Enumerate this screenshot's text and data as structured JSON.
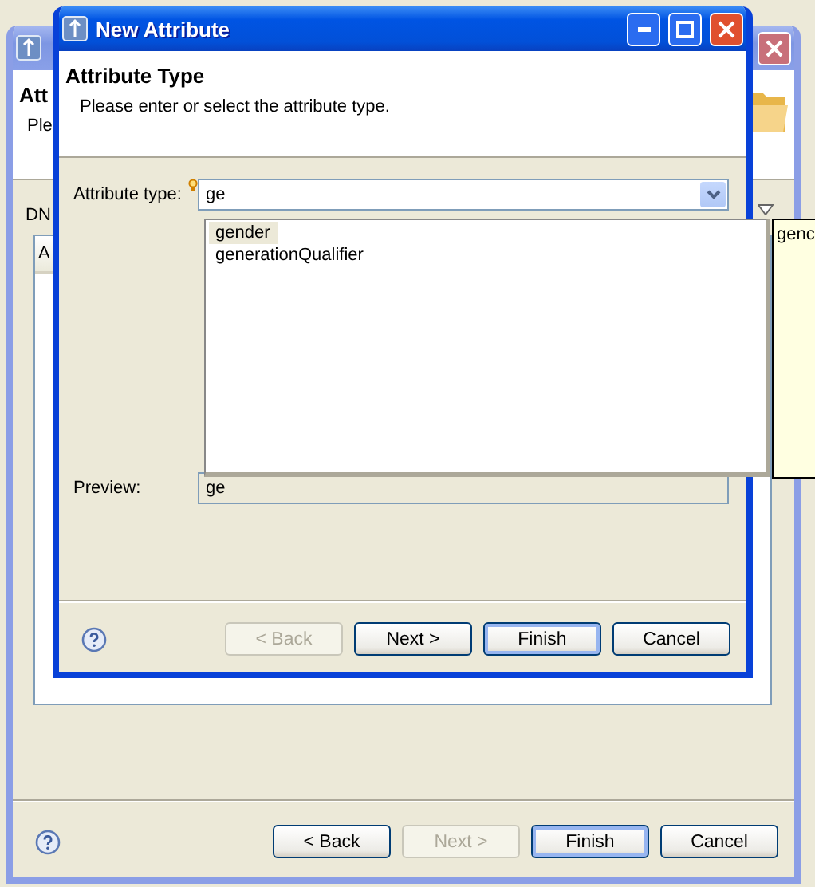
{
  "back_window": {
    "header_title": "Att",
    "header_message": "Ple",
    "dn_label": "DN",
    "table": {
      "columns": [
        "A"
      ]
    },
    "buttons": [
      {
        "label": "< Back",
        "disabled": false,
        "default": false
      },
      {
        "label": "Next >",
        "disabled": true,
        "default": false
      },
      {
        "label": "Finish",
        "disabled": false,
        "default": true
      },
      {
        "label": "Cancel",
        "disabled": false,
        "default": false
      }
    ]
  },
  "dialog": {
    "title": "New Attribute",
    "header_title": "Attribute Type",
    "header_message": "Please enter or select the attribute type.",
    "attribute_type": {
      "label": "Attribute type:",
      "value": "ge"
    },
    "suggestions": [
      {
        "label": "gender",
        "selected": true
      },
      {
        "label": "generationQualifier",
        "selected": false
      }
    ],
    "tooltip": "genc",
    "preview": {
      "label": "Preview:",
      "value": "ge"
    },
    "buttons": [
      {
        "label": "< Back",
        "disabled": true,
        "default": false
      },
      {
        "label": "Next >",
        "disabled": false,
        "default": false
      },
      {
        "label": "Finish",
        "disabled": false,
        "default": true
      },
      {
        "label": "Cancel",
        "disabled": false,
        "default": false
      }
    ]
  }
}
